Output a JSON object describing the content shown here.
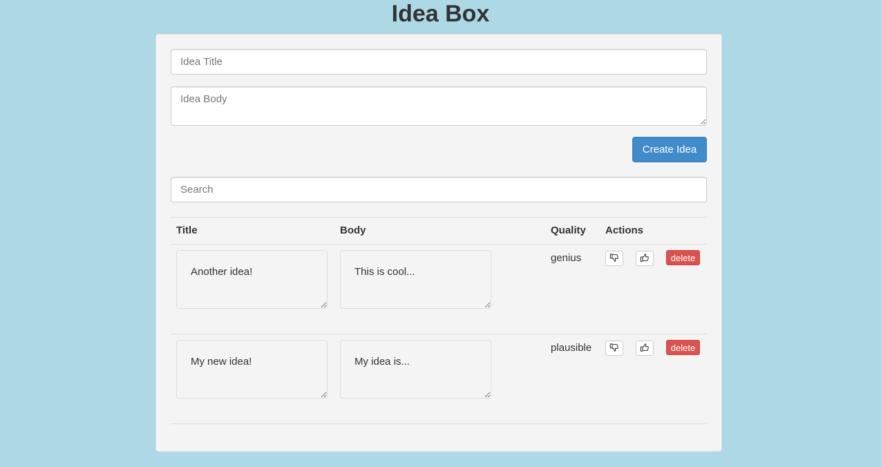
{
  "app": {
    "title": "Idea Box"
  },
  "form": {
    "title_placeholder": "Idea Title",
    "title_value": "",
    "body_placeholder": "Idea Body",
    "body_value": "",
    "create_label": "Create Idea"
  },
  "search": {
    "placeholder": "Search",
    "value": ""
  },
  "table": {
    "headers": {
      "title": "Title",
      "body": "Body",
      "quality": "Quality",
      "actions": "Actions"
    },
    "rows": [
      {
        "title": "Another idea!",
        "body": "This is cool...",
        "quality": "genius",
        "delete_label": "delete"
      },
      {
        "title": "My new idea!",
        "body": "My idea is...",
        "quality": "plausible",
        "delete_label": "delete"
      }
    ]
  },
  "icons": {
    "downvote": "thumbs-down-icon",
    "upvote": "thumbs-up-icon"
  },
  "colors": {
    "background": "#add8e6",
    "panel": "#f4f4f4",
    "primary_button": "#428bca",
    "danger_button": "#d9534f"
  }
}
